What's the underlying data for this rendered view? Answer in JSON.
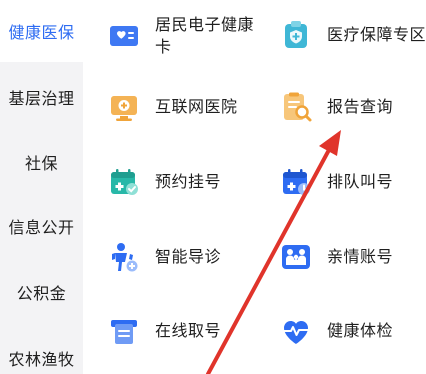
{
  "sidebar": {
    "items": [
      {
        "label": "健康医保",
        "active": true
      },
      {
        "label": "基层治理"
      },
      {
        "label": "社保"
      },
      {
        "label": "信息公开"
      },
      {
        "label": "公积金"
      },
      {
        "label": "农林渔牧"
      }
    ]
  },
  "services": [
    {
      "label": "居民电子健康卡",
      "label_line1": "居民电子健康",
      "label_line2": "卡",
      "icon": "health-card-icon",
      "color": "#2e6cf2"
    },
    {
      "label": "医疗保障专区",
      "icon": "medical-shield-icon",
      "color": "#3fb7d6"
    },
    {
      "label": "互联网医院",
      "icon": "online-hospital-icon",
      "color": "#f0a43a"
    },
    {
      "label": "报告查询",
      "icon": "report-search-icon",
      "color": "#f0a43a"
    },
    {
      "label": "预约挂号",
      "icon": "appointment-calendar-icon",
      "color": "#28b8a8"
    },
    {
      "label": "排队叫号",
      "icon": "queue-calendar-icon",
      "color": "#2e6cf2"
    },
    {
      "label": "智能导诊",
      "icon": "smart-guide-icon",
      "color": "#2e6cf2"
    },
    {
      "label": "亲情账号",
      "icon": "family-account-icon",
      "color": "#2e6cf2"
    },
    {
      "label": "在线取号",
      "icon": "online-ticket-icon",
      "color": "#2e6cf2"
    },
    {
      "label": "健康体检",
      "icon": "health-checkup-icon",
      "color": "#2e6cf2"
    }
  ],
  "annotation": {
    "color": "#e0342b"
  }
}
